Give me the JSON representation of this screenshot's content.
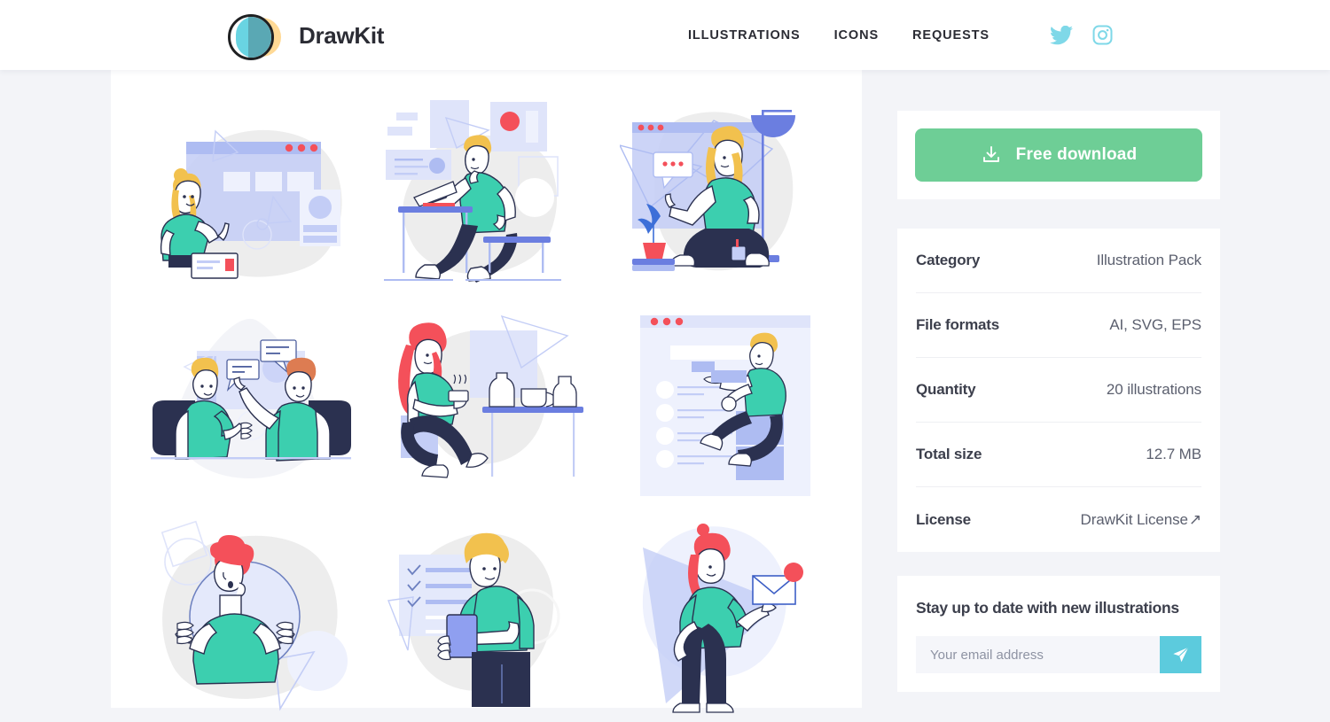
{
  "header": {
    "brand_name": "DrawKit",
    "logo_icon": "drawkit-logo-icon",
    "nav": [
      {
        "label": "ILLUSTRATIONS",
        "name": "nav-illustrations"
      },
      {
        "label": "ICONS",
        "name": "nav-icons"
      },
      {
        "label": "REQUESTS",
        "name": "nav-requests"
      }
    ],
    "social": [
      {
        "name": "twitter-icon",
        "color": "#7fd8e8"
      },
      {
        "name": "instagram-icon",
        "color": "#7fd8e8"
      }
    ]
  },
  "sidebar": {
    "download": {
      "label": "Free download",
      "icon": "download-icon",
      "color": "#6ece96"
    },
    "meta": [
      {
        "label": "Category",
        "value": "Illustration Pack"
      },
      {
        "label": "File formats",
        "value": "AI, SVG, EPS"
      },
      {
        "label": "Quantity",
        "value": "20 illustrations"
      },
      {
        "label": "Total size",
        "value": "12.7 MB"
      },
      {
        "label": "License",
        "value": "DrawKit License",
        "is_link": true,
        "link_icon": "↗"
      }
    ],
    "newsletter": {
      "title": "Stay up to date with new illustrations",
      "email_placeholder": "Your email address",
      "email_value": "",
      "submit_icon": "paper-plane-icon",
      "submit_color": "#5ccbdd"
    }
  },
  "gallery": {
    "items": [
      {
        "name": "illustration-woman-presenting-dashboard",
        "alt": "Woman pointing at a dashboard window"
      },
      {
        "name": "illustration-man-working-at-laptop",
        "alt": "Man sitting at desk working on a laptop"
      },
      {
        "name": "illustration-woman-sitting-with-chat",
        "alt": "Woman sitting cross-legged with chat bubble"
      },
      {
        "name": "illustration-two-men-talking",
        "alt": "Two men on chairs talking with speech bubbles"
      },
      {
        "name": "illustration-woman-coffee-break",
        "alt": "Woman with red hair holding a hot drink"
      },
      {
        "name": "illustration-man-sitting-on-list-window",
        "alt": "Man sitting on a browser window with list items"
      },
      {
        "name": "illustration-man-in-circle-confused",
        "alt": "Man with red hair inside a circle"
      },
      {
        "name": "illustration-man-with-checklist",
        "alt": "Man holding tablet next to a checklist"
      },
      {
        "name": "illustration-woman-holding-envelope",
        "alt": "Woman holding an envelope with notification"
      }
    ]
  },
  "colors": {
    "page_background": "#f3f4f8",
    "content_background": "#ffffff",
    "accent_green": "#6ece96",
    "accent_cyan": "#5ccbdd",
    "illustration_blue": "#c3cdf6",
    "illustration_teal": "#3ccfaf",
    "illustration_navy": "#2b3150",
    "illustration_yellow": "#f2c14e",
    "illustration_red": "#f4505a",
    "illustration_gray": "#ededed"
  }
}
